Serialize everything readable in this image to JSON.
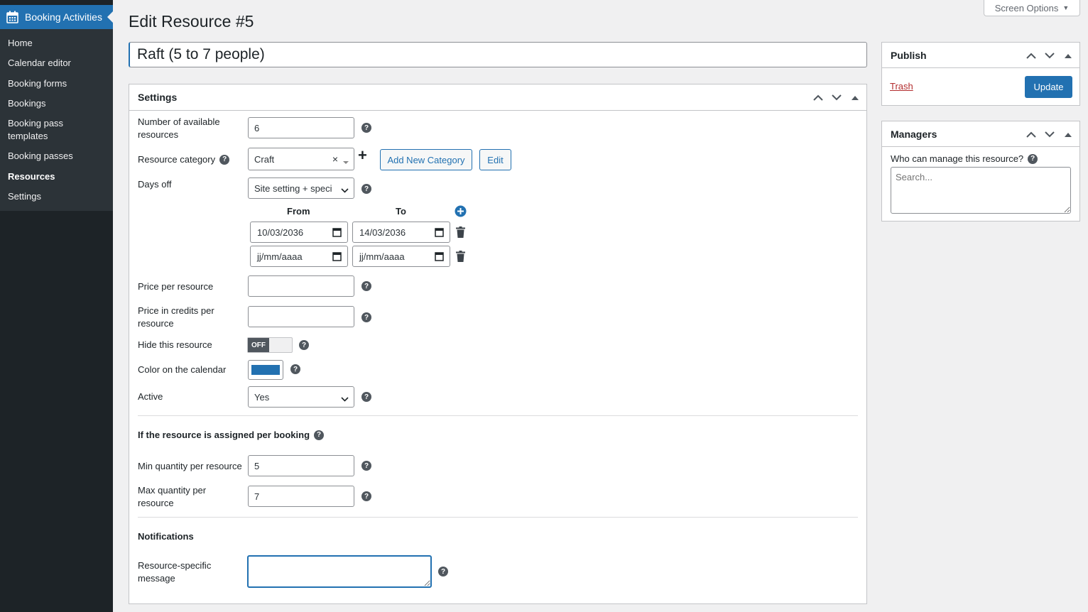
{
  "sidebar": {
    "header_label": "Booking Activities",
    "items": [
      {
        "label": "Home"
      },
      {
        "label": "Calendar editor"
      },
      {
        "label": "Booking forms"
      },
      {
        "label": "Bookings"
      },
      {
        "label": "Booking pass templates"
      },
      {
        "label": "Booking passes"
      },
      {
        "label": "Resources"
      },
      {
        "label": "Settings"
      }
    ]
  },
  "screen_options": {
    "label": "Screen Options"
  },
  "page": {
    "title": "Edit Resource #5",
    "resource_title": "Raft (5 to 7 people)"
  },
  "settings": {
    "title": "Settings",
    "available_label": "Number of available resources",
    "available_value": "6",
    "category_label": "Resource category",
    "category_value": "Craft",
    "clear_symbol": "×",
    "add_symbol": "+",
    "add_category_label": "Add New Category",
    "edit_label": "Edit",
    "days_off_label": "Days off",
    "days_off_value": "Site setting + speci",
    "from_label": "From",
    "to_label": "To",
    "date_rows": [
      {
        "from": "10/03/2036",
        "to": "14/03/2036"
      },
      {
        "from": "jj/mm/aaaa",
        "to": "jj/mm/aaaa"
      }
    ],
    "price_label": "Price per resource",
    "price_value": "",
    "credits_label": "Price in credits per resource",
    "credits_value": "",
    "hide_label": "Hide this resource",
    "hide_toggle": "OFF",
    "color_label": "Color on the calendar",
    "color_value": "#2271b1",
    "active_label": "Active",
    "active_value": "Yes",
    "per_booking_title": "If the resource is assigned per booking",
    "min_label": "Min quantity per resource",
    "min_value": "5",
    "max_label": "Max quantity per resource",
    "max_value": "7",
    "notifications_title": "Notifications",
    "message_label": "Resource-specific message",
    "help_symbol": "?"
  },
  "publish": {
    "title": "Publish",
    "trash_label": "Trash",
    "update_label": "Update"
  },
  "managers": {
    "title": "Managers",
    "question": "Who can manage this resource?",
    "search_placeholder": "Search..."
  }
}
